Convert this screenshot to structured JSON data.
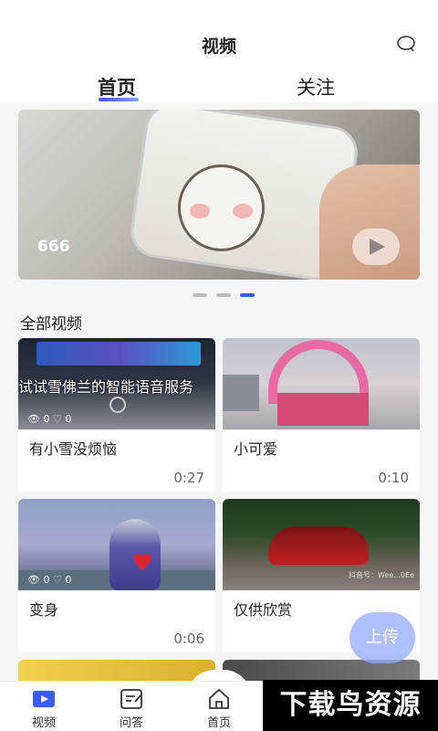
{
  "header": {
    "title": "视频",
    "message_icon": "chat-bubble-icon"
  },
  "tabs": [
    {
      "label": "首页",
      "active": true
    },
    {
      "label": "关注",
      "active": false
    }
  ],
  "banner": {
    "views": "666",
    "play_icon": "play-icon",
    "pager": {
      "count": 3,
      "active": 3
    }
  },
  "section": {
    "title": "全部视频"
  },
  "videos": [
    {
      "overlay_text": "试试雪佛兰的智能语音服务",
      "screen_labels": "车机  苹果CarPlay  百度CarLife",
      "views": "0",
      "likes": "0",
      "caption": "有小雪没烦恼",
      "duration": "0:27"
    },
    {
      "caption": "小可爱",
      "duration": "0:10"
    },
    {
      "views": "0",
      "likes": "0",
      "caption": "变身",
      "duration": "0:06"
    },
    {
      "watermark": "抖音号：Wee...0Ee",
      "caption": "仅供欣赏",
      "duration": ""
    }
  ],
  "upload": {
    "label": "上传"
  },
  "bottom_nav": [
    {
      "label": "视频",
      "icon": "video-play-icon",
      "active": true
    },
    {
      "label": "问答",
      "icon": "edit-note-icon",
      "active": false
    },
    {
      "label": "首页",
      "icon": "home-icon",
      "active": false
    }
  ],
  "watermark_overlay": {
    "text": "下载鸟资源"
  },
  "colors": {
    "accent": "#3b5bff",
    "upload_bg": "#96aaff"
  }
}
